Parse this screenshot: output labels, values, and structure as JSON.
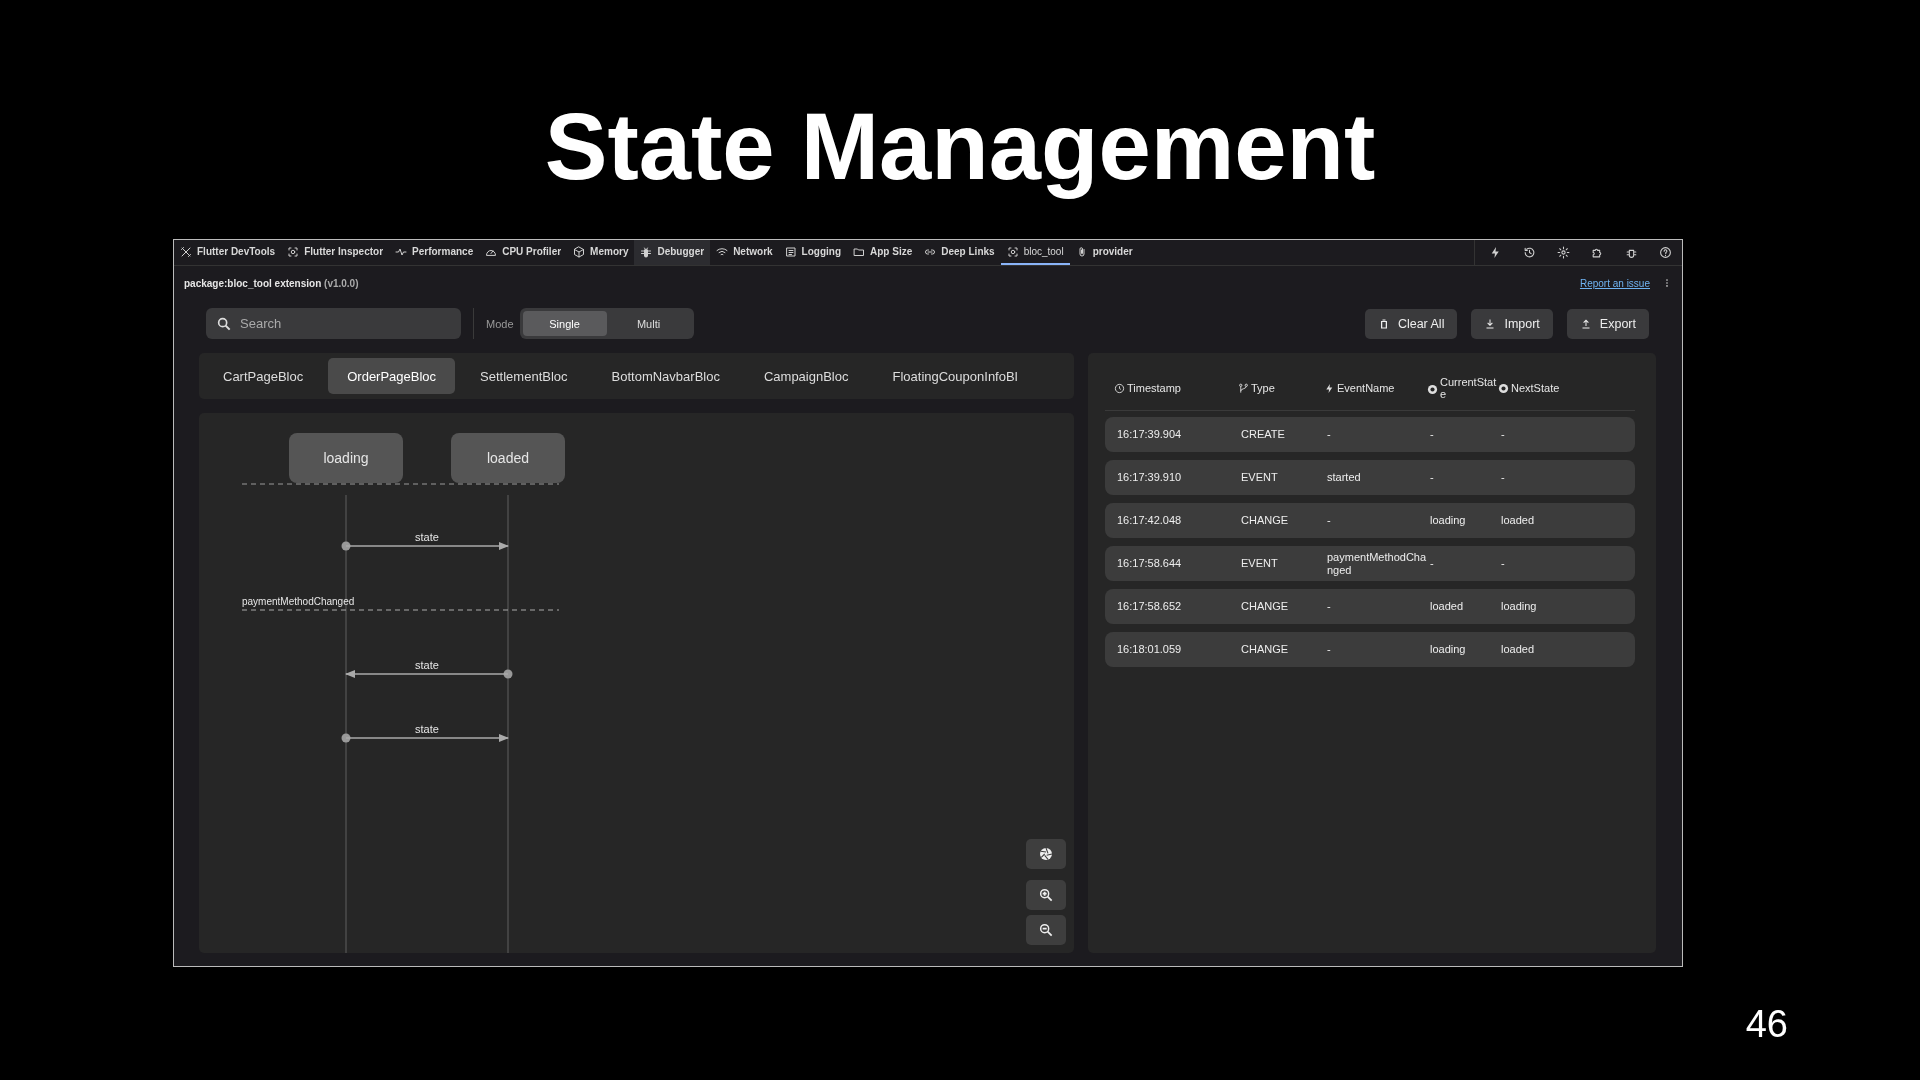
{
  "slide": {
    "title": "State Management",
    "page_number": "46"
  },
  "devtools": {
    "app_title": "Flutter DevTools",
    "tabs": [
      {
        "label": "Flutter Inspector",
        "selected": false,
        "highlighted": false
      },
      {
        "label": "Performance",
        "selected": false,
        "highlighted": false
      },
      {
        "label": "CPU Profiler",
        "selected": false,
        "highlighted": false
      },
      {
        "label": "Memory",
        "selected": false,
        "highlighted": false
      },
      {
        "label": "Debugger",
        "selected": false,
        "highlighted": true
      },
      {
        "label": "Network",
        "selected": false,
        "highlighted": false
      },
      {
        "label": "Logging",
        "selected": false,
        "highlighted": false
      },
      {
        "label": "App Size",
        "selected": false,
        "highlighted": false
      },
      {
        "label": "Deep Links",
        "selected": false,
        "highlighted": false
      },
      {
        "label": "bloc_tool",
        "selected": true,
        "highlighted": false
      },
      {
        "label": "provider",
        "selected": false,
        "highlighted": false
      }
    ],
    "extension": {
      "name": "package:bloc_tool extension",
      "version": "(v1.0.0)",
      "link": "Report an issue"
    },
    "search": {
      "placeholder": "Search"
    },
    "mode": {
      "label": "Mode",
      "options": [
        {
          "label": "Single",
          "selected": true
        },
        {
          "label": "Multi",
          "selected": false
        }
      ]
    },
    "actions": [
      "Clear All",
      "Import",
      "Export"
    ],
    "bloc_tabs": [
      {
        "label": "CartPageBloc",
        "selected": false
      },
      {
        "label": "OrderPageBloc",
        "selected": true
      },
      {
        "label": "SettlementBloc",
        "selected": false
      },
      {
        "label": "BottomNavbarBloc",
        "selected": false
      },
      {
        "label": "CampaignBloc",
        "selected": false
      },
      {
        "label": "FloatingCouponInfoBl",
        "selected": false
      }
    ],
    "diagram": {
      "states": [
        "loading",
        "loaded"
      ],
      "messages": [
        {
          "kind": "state",
          "label": "state",
          "reversed": false
        },
        {
          "kind": "event",
          "label": "paymentMethodChanged"
        },
        {
          "kind": "state",
          "label": "state",
          "reversed": true
        },
        {
          "kind": "state",
          "label": "state",
          "reversed": false
        }
      ]
    },
    "table": {
      "columns": [
        "Timestamp",
        "Type",
        "EventName",
        "CurrentState",
        "NextState"
      ],
      "rows": [
        [
          "16:17:39.904",
          "CREATE",
          "-",
          "-",
          "-"
        ],
        [
          "16:17:39.910",
          "EVENT",
          "started",
          "-",
          "-"
        ],
        [
          "16:17:42.048",
          "CHANGE",
          "-",
          "loading",
          "loaded"
        ],
        [
          "16:17:58.644",
          "EVENT",
          "paymentMethodChanged",
          "-",
          "-"
        ],
        [
          "16:17:58.652",
          "CHANGE",
          "-",
          "loaded",
          "loading"
        ],
        [
          "16:18:01.059",
          "CHANGE",
          "-",
          "loading",
          "loaded"
        ]
      ]
    }
  }
}
